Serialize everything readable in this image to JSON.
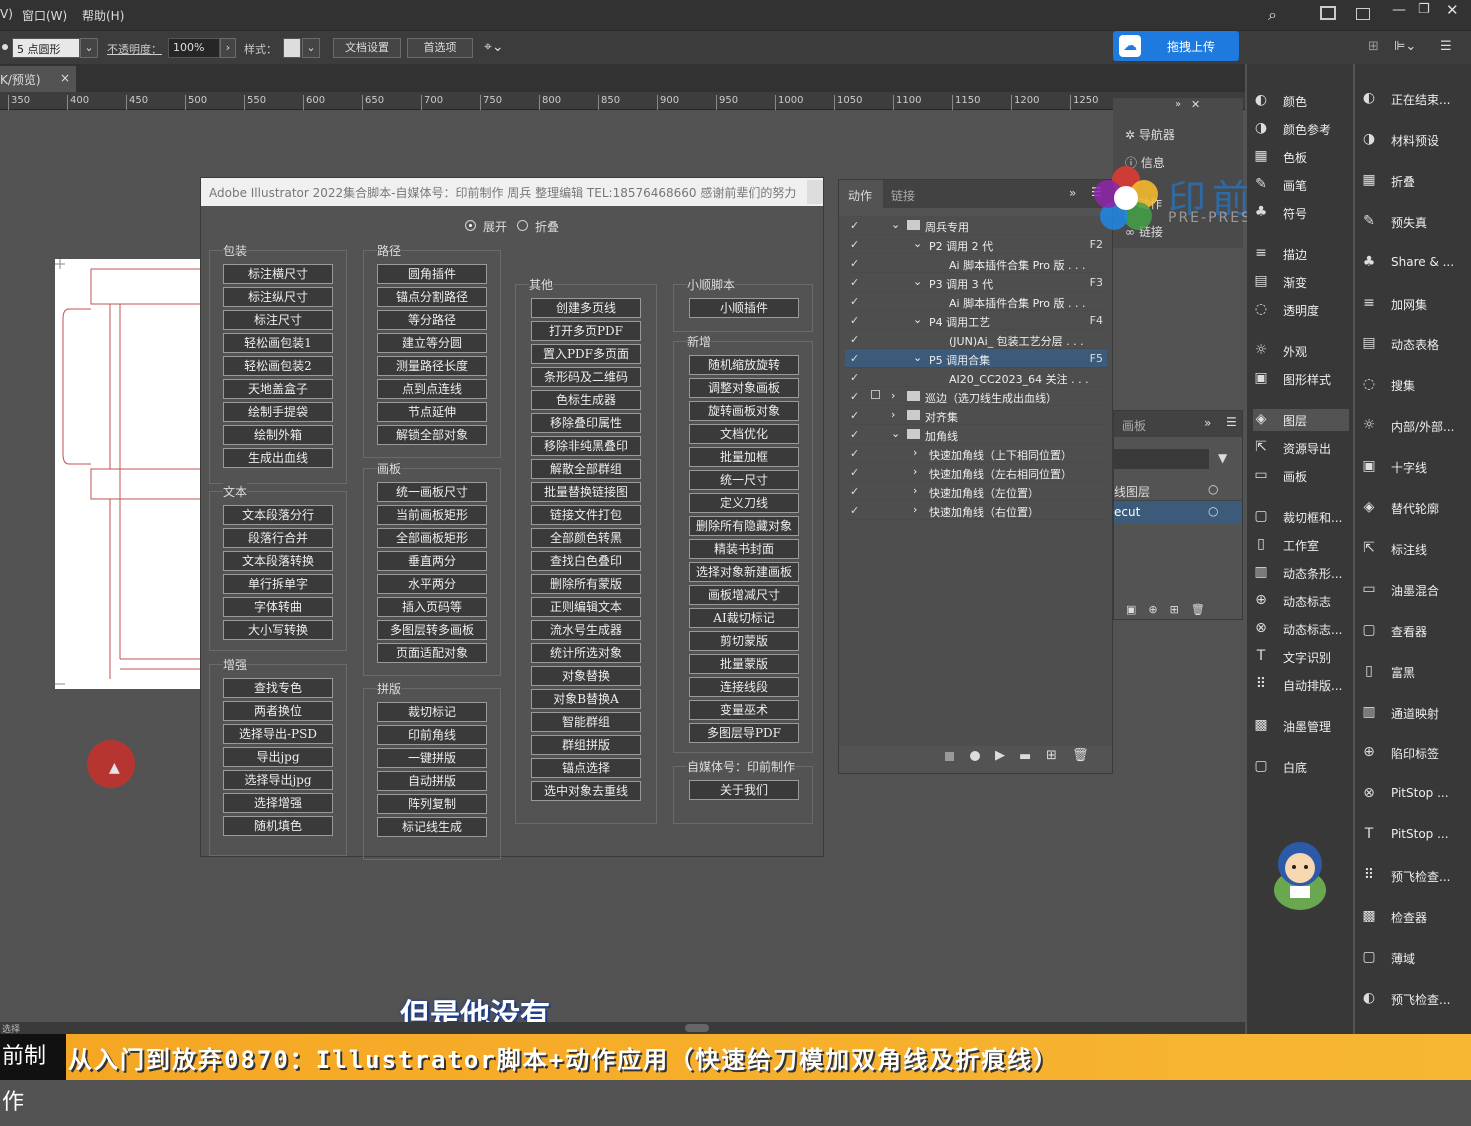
{
  "menubar": {
    "items": [
      "V)",
      "窗口(W)",
      "帮助(H)"
    ]
  },
  "control_bar": {
    "stroke_profile": "5 点圆形",
    "opacity_label": "不透明度：",
    "opacity_value": "100%",
    "style_label": "样式：",
    "doc_setup": "文档设置",
    "preferences": "首选项"
  },
  "upload_button": "拖拽上传",
  "doc_tab": "K/预览)",
  "doc_tab_close": "×",
  "ruler": [
    "350",
    "400",
    "450",
    "500",
    "550",
    "600",
    "650",
    "700",
    "750",
    "800",
    "850",
    "900",
    "950",
    "1000",
    "1050",
    "1100",
    "1150",
    "1200",
    "1250"
  ],
  "dialog": {
    "title": "Adobe Illustrator 2022集合脚本-自媒体号：印前制作 周兵 整理编辑 TEL:18576468660 感谢前辈们的努力",
    "radio_expand": "展开",
    "radio_fold": "折叠",
    "groups": {
      "packaging": {
        "title": "包装",
        "buttons": [
          "标注横尺寸",
          "标注纵尺寸",
          "标注尺寸",
          "轻松画包装1",
          "轻松画包装2",
          "天地盖盒子",
          "绘制手提袋",
          "绘制外箱",
          "生成出血线"
        ]
      },
      "text": {
        "title": "文本",
        "buttons": [
          "文本段落分行",
          "段落行合并",
          "文本段落转换",
          "单行拆单字",
          "字体转曲",
          "大小写转换"
        ]
      },
      "enhance": {
        "title": "增强",
        "buttons": [
          "查找专色",
          "两者换位",
          "选择导出-PSD",
          "导出jpg",
          "选择导出jpg",
          "选择增强",
          "随机填色"
        ]
      },
      "path": {
        "title": "路径",
        "buttons": [
          "圆角插件",
          "锚点分割路径",
          "等分路径",
          "建立等分圆",
          "测量路径长度",
          "点到点连线",
          "节点延伸",
          "解锁全部对象"
        ]
      },
      "artboard": {
        "title": "画板",
        "buttons": [
          "统一画板尺寸",
          "当前画板矩形",
          "全部画板矩形",
          "垂直两分",
          "水平两分",
          "插入页码等",
          "多图层转多画板",
          "页面适配对象"
        ]
      },
      "imposition": {
        "title": "拼版",
        "buttons": [
          "裁切标记",
          "印前角线",
          "一键拼版",
          "自动拼版",
          "阵列复制",
          "标记线生成"
        ]
      },
      "other": {
        "title": "其他",
        "buttons": [
          "创建多页线",
          "打开多页PDF",
          "置入PDF多页面",
          "条形码及二维码",
          "色标生成器",
          "移除叠印属性",
          "移除非纯黑叠印",
          "解散全部群组",
          "批量替换链接图",
          "链接文件打包",
          "全部颜色转黑",
          "查找白色叠印",
          "删除所有蒙版",
          "正则编辑文本",
          "流水号生成器",
          "统计所选对象",
          "对象替换",
          "对象B替换A",
          "智能群组",
          "群组拼版",
          "锚点选择",
          "选中对象去重线"
        ]
      },
      "xiaoshun": {
        "title": "小顺脚本",
        "buttons": [
          "小顺插件"
        ]
      },
      "new": {
        "title": "新增",
        "buttons": [
          "随机缩放旋转",
          "调整对象画板",
          "旋转画板对象",
          "文档优化",
          "批量加框",
          "统一尺寸",
          "定义刀线",
          "删除所有隐藏对象",
          "精装书封面",
          "选择对象新建画板",
          "画板增减尺寸",
          "AI裁切标记",
          "剪切蒙版",
          "批量蒙版",
          "连接线段",
          "变量巫术",
          "多图层导PDF"
        ]
      },
      "media": {
        "title": "自媒体号：印前制作",
        "buttons": [
          "关于我们"
        ]
      }
    }
  },
  "actions_panel": {
    "tabs": [
      "动作",
      "链接"
    ],
    "rows": [
      {
        "indent": 0,
        "arrow": "v",
        "folder": true,
        "text": "周兵专用",
        "key": ""
      },
      {
        "indent": 1,
        "arrow": "v",
        "folder": false,
        "text": "P2 调用 2 代",
        "key": "F2"
      },
      {
        "indent": 2,
        "arrow": "",
        "folder": false,
        "text": "Ai 脚本插件合集 Pro 版 . . .",
        "key": ""
      },
      {
        "indent": 1,
        "arrow": "v",
        "folder": false,
        "text": "P3 调用 3 代",
        "key": "F3"
      },
      {
        "indent": 2,
        "arrow": "",
        "folder": false,
        "text": "Ai 脚本插件合集 Pro 版 . . .",
        "key": ""
      },
      {
        "indent": 1,
        "arrow": "v",
        "folder": false,
        "text": "P4 调用工艺",
        "key": "F4"
      },
      {
        "indent": 2,
        "arrow": "",
        "folder": false,
        "text": "(JUN)Ai_ 包装工艺分层 . . .",
        "key": ""
      },
      {
        "indent": 1,
        "arrow": "v",
        "folder": false,
        "text": "P5 调用合集",
        "key": "F5",
        "selected": true
      },
      {
        "indent": 2,
        "arrow": "",
        "folder": false,
        "text": "AI20_CC2023_64 关注 . . .",
        "key": ""
      },
      {
        "indent": 0,
        "arrow": ">",
        "folder": true,
        "text": "巡边（选刀线生成出血线）",
        "key": "",
        "dialog": true
      },
      {
        "indent": 0,
        "arrow": ">",
        "folder": true,
        "text": "对齐集",
        "key": ""
      },
      {
        "indent": 0,
        "arrow": "v",
        "folder": true,
        "text": "加角线",
        "key": ""
      },
      {
        "indent": 1,
        "arrow": ">",
        "folder": false,
        "text": "快速加角线（上下相同位置）",
        "key": ""
      },
      {
        "indent": 1,
        "arrow": ">",
        "folder": false,
        "text": "快速加角线（左右相同位置）",
        "key": ""
      },
      {
        "indent": 1,
        "arrow": ">",
        "folder": false,
        "text": "快速加角线（左位置）",
        "key": ""
      },
      {
        "indent": 1,
        "arrow": ">",
        "folder": false,
        "text": "快速加角线（右位置）",
        "key": ""
      }
    ]
  },
  "mini_panel": {
    "items": [
      "导航器",
      "信息",
      "动作",
      "链接"
    ]
  },
  "layers_panel": {
    "tab": "画板",
    "rows": [
      "线图层",
      "ecut"
    ]
  },
  "dock1": {
    "items": [
      "颜色",
      "颜色参考",
      "色板",
      "画笔",
      "符号",
      "描边",
      "渐变",
      "透明度",
      "外观",
      "图形样式",
      "图层",
      "资源导出",
      "画板",
      "裁切框和...",
      "工作室",
      "动态条形...",
      "动态标志",
      "动态标志...",
      "文字识别",
      "自动排版...",
      "油墨管理",
      "白底"
    ]
  },
  "dock2": {
    "items": [
      "正在结束...",
      "材料预设",
      "折叠",
      "预失真",
      "Share & ...",
      "加网集",
      "动态表格",
      "搜集",
      "内部/外部...",
      "十字线",
      "替代轮廓",
      "标注线",
      "油墨混合",
      "查看器",
      "富黑",
      "通道映射",
      "陷印标签",
      "PitStop ...",
      "PitStop ...",
      "预飞检查...",
      "检查器",
      "薄域",
      "预飞检查..."
    ]
  },
  "watermark": {
    "title": "印前制作",
    "sub": "PRE-PRESS PRINTING"
  },
  "caption": "但是他没有",
  "banner": {
    "left": "前制作",
    "text": "从入门到放弃0870：Illustrator脚本+动作应用（快速给刀模加双角线及折痕线）"
  },
  "statusbar": "选择",
  "colors": {
    "accent_blue": "#1f7ae0",
    "banner_orange": "#f5a623",
    "stroke_red": "#c0504d"
  }
}
